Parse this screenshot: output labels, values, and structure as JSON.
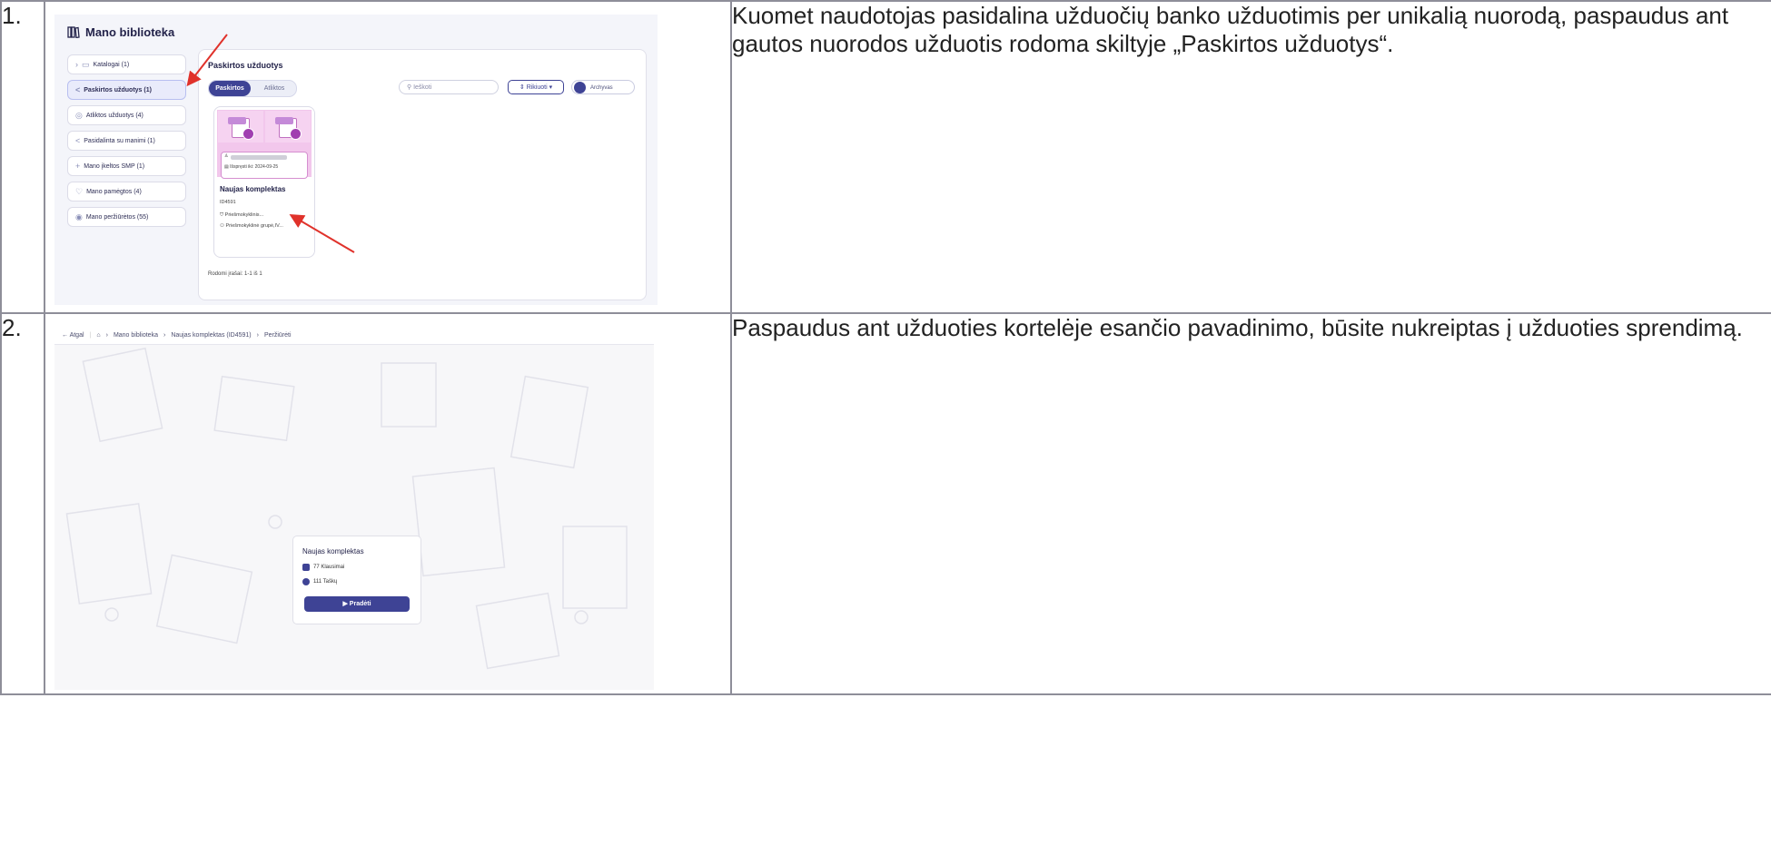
{
  "rows": [
    {
      "number": "1.",
      "description": "Kuomet naudotojas pasidalina užduočių banko užduotimis per unikalią nuorodą, paspaudus ant gautos nuorodos užduotis rodoma skiltyje „Paskirtos užduotys“.",
      "screenshot": {
        "library_title": "Mano biblioteka",
        "sidebar": [
          {
            "label": "Katalogai  (1)",
            "icon": "folder-icon"
          },
          {
            "label": "Paskirtos užduotys  (1)",
            "icon": "share-icon",
            "active": true
          },
          {
            "label": "Atliktos užduotys  (4)",
            "icon": "check-circle-icon"
          },
          {
            "label": "Pasidalinta su manimi  (1)",
            "icon": "share-icon"
          },
          {
            "label": "Mano įkeltos SMP  (1)",
            "icon": "plus-icon"
          },
          {
            "label": "Mano pamėgtos  (4)",
            "icon": "heart-icon"
          },
          {
            "label": "Mano peržiūrėtos  (55)",
            "icon": "eye-icon"
          }
        ],
        "panel_title": "Paskirtos užduotys",
        "tabs": [
          "Paskirtos",
          "Atliktos"
        ],
        "search_placeholder": "Ieškoti",
        "sort_label": "Rikiuoti",
        "archive_label": "Archyvas",
        "card": {
          "due": "Išspręsti iki: 2024-09-25",
          "title": "Naujas komplektas",
          "id": "ID4591",
          "meta1": "Priešmokyklinis...",
          "meta2": "Priešmokyklinė grupė,IV..."
        },
        "footer": "Rodomi įrašai: 1-1 iš 1"
      }
    },
    {
      "number": "2.",
      "description": "Paspaudus ant užduoties kortelėje esančio pavadinimo, būsite nukreiptas į užduoties sprendimą.",
      "screenshot": {
        "breadcrumb": {
          "back": "Atgal",
          "items": [
            "Mano biblioteka",
            "Naujas komplektas (ID4591)",
            "Peržiūrėti"
          ]
        },
        "card": {
          "title": "Naujas komplektas",
          "questions": "77 Klausimai",
          "points": "111 Taškų",
          "start_button": "Pradėti"
        }
      }
    }
  ]
}
